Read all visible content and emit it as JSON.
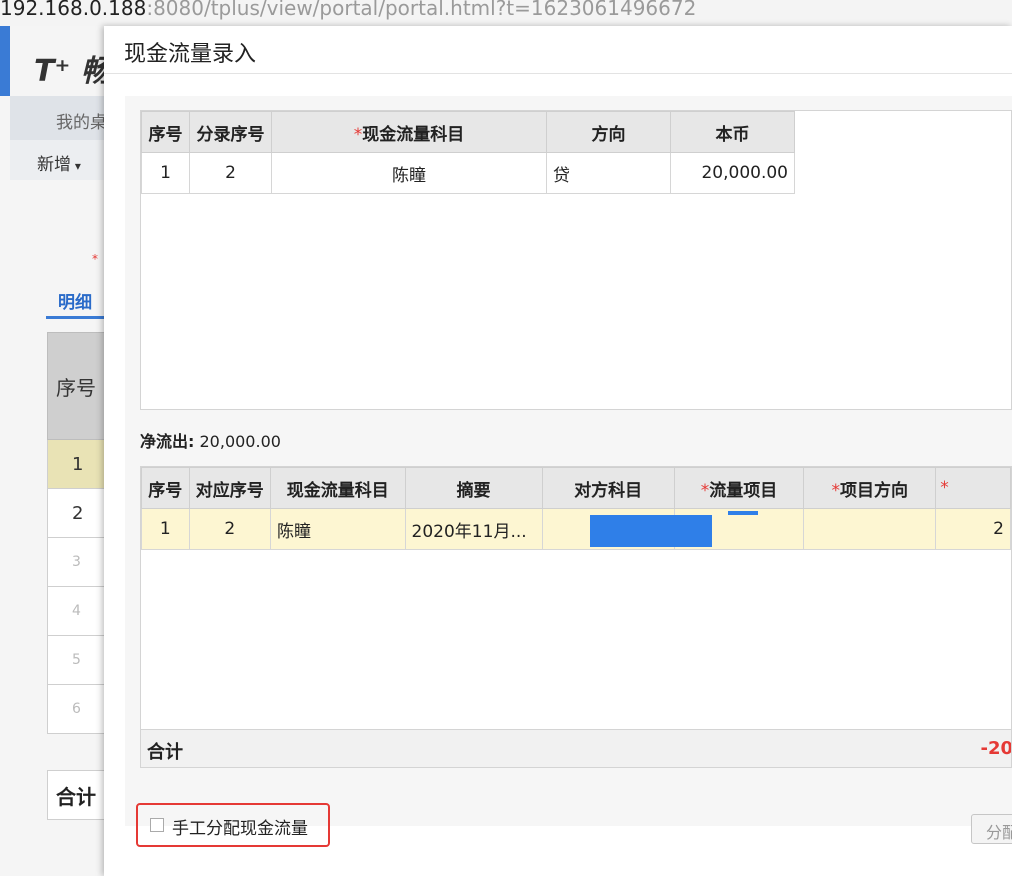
{
  "browser": {
    "url_host": "192.168.0.188",
    "url_path": ":8080/tplus/view/portal/portal.html?t=1623061496672"
  },
  "background": {
    "logo": "T⁺ 畅",
    "nav_item": "我的桌",
    "new_button": "新增",
    "required_mark": "*",
    "tab_detail": "明细",
    "grid_header": "序号",
    "rows": [
      "1",
      "2",
      "3",
      "4",
      "5",
      "6"
    ],
    "total_label": "合计"
  },
  "dialog": {
    "title": "现金流量录入",
    "required_mark": "*",
    "top_grid": {
      "headers": {
        "seq": "序号",
        "entry_seq": "分录序号",
        "cash_flow_subject": "现金流量科目",
        "direction": "方向",
        "local_currency": "本币"
      },
      "rows": [
        {
          "seq": "1",
          "entry_seq": "2",
          "cash_flow_subject": "陈瞳",
          "direction": "贷",
          "local_currency": "20,000.00"
        }
      ]
    },
    "net_outflow": {
      "label": "净流出:",
      "value": "20,000.00"
    },
    "bottom_grid": {
      "headers": {
        "seq": "序号",
        "match_seq": "对应序号",
        "cash_flow_subject": "现金流量科目",
        "summary": "摘要",
        "counter_subject": "对方科目",
        "flow_item": "流量项目",
        "item_direction": "项目方向",
        "amount": ""
      },
      "rows": [
        {
          "seq": "1",
          "match_seq": "2",
          "cash_flow_subject": "陈瞳",
          "summary": "2020年11月...",
          "counter_subject": "",
          "flow_item": "",
          "item_direction": "",
          "amount": "2"
        }
      ],
      "total_label": "合计",
      "total_value": "-20"
    },
    "manual_allocate_label": "手工分配现金流量",
    "allocate_button": "分配"
  },
  "colors": {
    "accent_blue": "#2f7fe8",
    "required_red": "#e53935",
    "selected_row": "#fdf6d2"
  }
}
